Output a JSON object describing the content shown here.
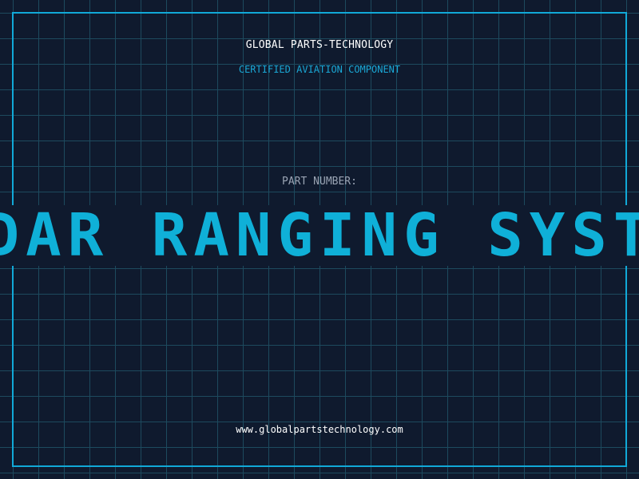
{
  "header": {
    "company": "GLOBAL PARTS-TECHNOLOGY",
    "subtitle": "CERTIFIED AVIATION COMPONENT"
  },
  "part": {
    "label": "PART NUMBER:",
    "name": "RADAR RANGING SYSTEM"
  },
  "footer": {
    "website": "www.globalpartstechnology.com"
  },
  "colors": {
    "background": "#0f1a2e",
    "grid": "#1d4a5e",
    "accent": "#11a9d8",
    "text": "#ffffff",
    "muted": "#9aa4b4"
  }
}
